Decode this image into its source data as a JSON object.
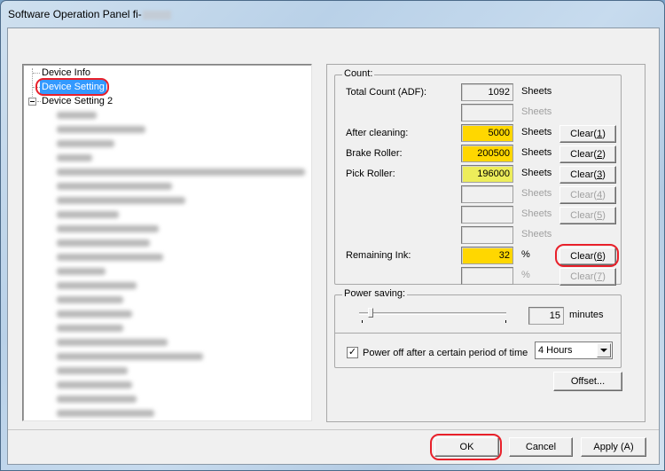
{
  "window": {
    "title": "Software Operation Panel fi-",
    "title_redacted": true
  },
  "tree": {
    "items": [
      {
        "label": "Device Info",
        "level": 1,
        "selected": false
      },
      {
        "label": "Device Setting",
        "level": 1,
        "selected": true,
        "highlighted": true
      },
      {
        "label": "Device Setting 2",
        "level": 1,
        "expanded": true
      }
    ],
    "redacted_children_count": 23
  },
  "count": {
    "title": "Count:",
    "rows": [
      {
        "label": "Total Count (ADF):",
        "value": "1092",
        "unit": "Sheets",
        "unit_enabled": true,
        "color": "none"
      },
      {
        "label": "",
        "value": "",
        "unit": "Sheets",
        "unit_enabled": false,
        "color": "none"
      },
      {
        "label": "After cleaning:",
        "value": "5000",
        "unit": "Sheets",
        "unit_enabled": true,
        "color": "#ffd700",
        "button": "Clear(1)",
        "button_enabled": true
      },
      {
        "label": "Brake Roller:",
        "value": "200500",
        "unit": "Sheets",
        "unit_enabled": true,
        "color": "#ffd700",
        "button": "Clear(2)",
        "button_enabled": true
      },
      {
        "label": "Pick Roller:",
        "value": "196000",
        "unit": "Sheets",
        "unit_enabled": true,
        "color": "#eded5a",
        "button": "Clear(3)",
        "button_enabled": true
      },
      {
        "label": "",
        "value": "",
        "unit": "Sheets",
        "unit_enabled": false,
        "button": "Clear(4)",
        "button_enabled": false
      },
      {
        "label": "",
        "value": "",
        "unit": "Sheets",
        "unit_enabled": false,
        "button": "Clear(5)",
        "button_enabled": false
      },
      {
        "label": "",
        "value": "",
        "unit": "Sheets",
        "unit_enabled": false
      },
      {
        "label": "Remaining Ink:",
        "value": "32",
        "unit": "%",
        "unit_enabled": true,
        "color": "#ffd700",
        "button": "Clear(6)",
        "button_enabled": true,
        "highlighted": true
      },
      {
        "label": "",
        "value": "",
        "unit": "%",
        "unit_enabled": false,
        "button": "Clear(7)",
        "button_enabled": false
      }
    ]
  },
  "power_saving": {
    "title": "Power saving:",
    "value": "15",
    "unit": "minutes",
    "slider_fraction": 0.06,
    "power_off_label": "Power off after a certain period of time",
    "power_off_checked": true,
    "power_off_period": "4 Hours"
  },
  "buttons": {
    "offset": "Offset...",
    "ok": "OK",
    "cancel": "Cancel",
    "apply": "Apply (A)"
  },
  "colors": {
    "selection": "#3399ff",
    "highlight_oval": "#e8202a",
    "warning_orange": "#ffd700",
    "warning_yellow": "#eded5a"
  }
}
